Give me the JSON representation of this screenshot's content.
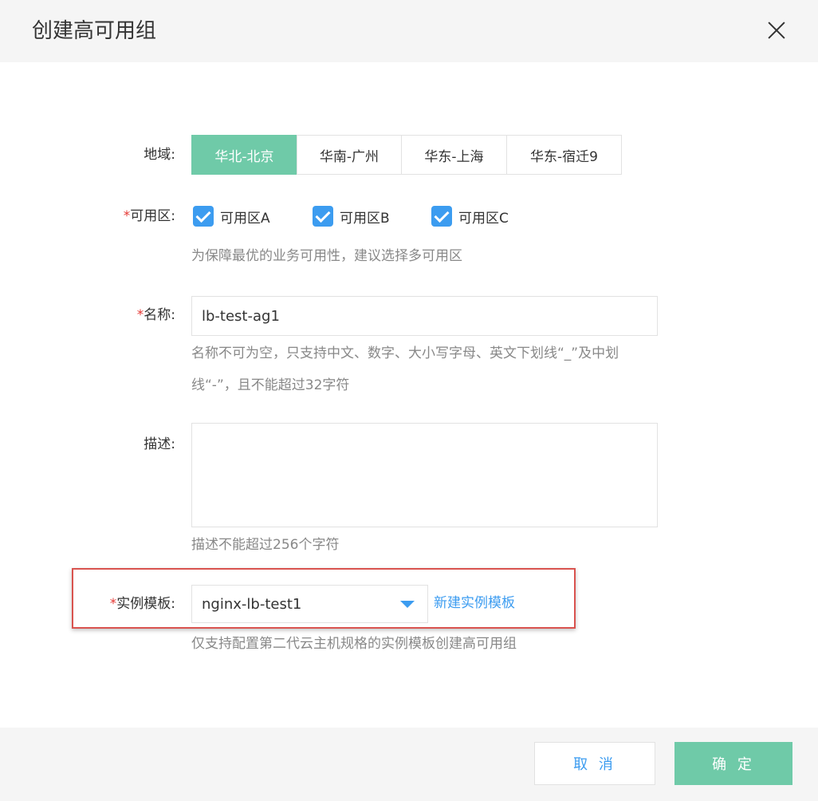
{
  "dialog": {
    "title": "创建高可用组",
    "close_icon": "close-icon"
  },
  "form": {
    "region": {
      "label": "地域:",
      "options": [
        "华北-北京",
        "华南-广州",
        "华东-上海",
        "华东-宿迁9"
      ],
      "selected": "华北-北京",
      "active_color": "#6fcaa8"
    },
    "zone": {
      "required_mark": "*",
      "label": "可用区:",
      "options": [
        {
          "label": "可用区A",
          "checked": true
        },
        {
          "label": "可用区B",
          "checked": true
        },
        {
          "label": "可用区C",
          "checked": true
        }
      ],
      "hint": "为保障最优的业务可用性，建议选择多可用区",
      "check_color": "#3c9cf0"
    },
    "name": {
      "required_mark": "*",
      "label": "名称:",
      "value": "lb-test-ag1",
      "hint_line1": "名称不可为空，只支持中文、数字、大小写字母、英文下划线“_”及中划",
      "hint_line2": "线“-”，且不能超过32字符"
    },
    "description": {
      "label": "描述:",
      "value": "",
      "hint": "描述不能超过256个字符"
    },
    "template": {
      "required_mark": "*",
      "label": "实例模板:",
      "selected": "nginx-lb-test1",
      "create_link": "新建实例模板",
      "hint": "仅支持配置第二代云主机规格的实例模板创建高可用组",
      "highlight_color": "#d9534f"
    }
  },
  "footer": {
    "cancel_label": "取 消",
    "confirm_label": "确 定"
  }
}
